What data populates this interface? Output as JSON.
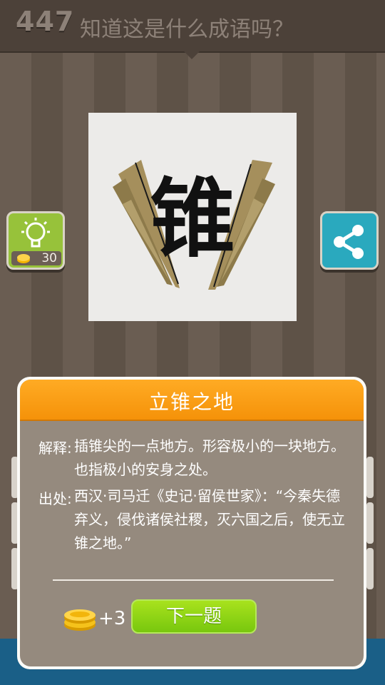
{
  "header": {
    "level": "447",
    "question": "知道这是什么成语吗？"
  },
  "puzzle": {
    "image_character": "锥"
  },
  "hint_button": {
    "icon": "lightbulb-icon",
    "cost": "30",
    "color": "#97c23a"
  },
  "share_button": {
    "icon": "share-icon",
    "color": "#2aa9be"
  },
  "answer_popup": {
    "title": "立锥之地",
    "explain_label": "解释:",
    "explain_text": "插锥尖的一点地方。形容极小的一块地方。也指极小的安身之处。",
    "source_label": "出处:",
    "source_text": "西汉·司马迁《史记·留侯世家》：“今秦失德弃义，侵伐诸侯社稷，灭六国之后，使无立锥之地。”",
    "reward": "+3",
    "next_button": "下一题",
    "header_color": "#f59209"
  }
}
